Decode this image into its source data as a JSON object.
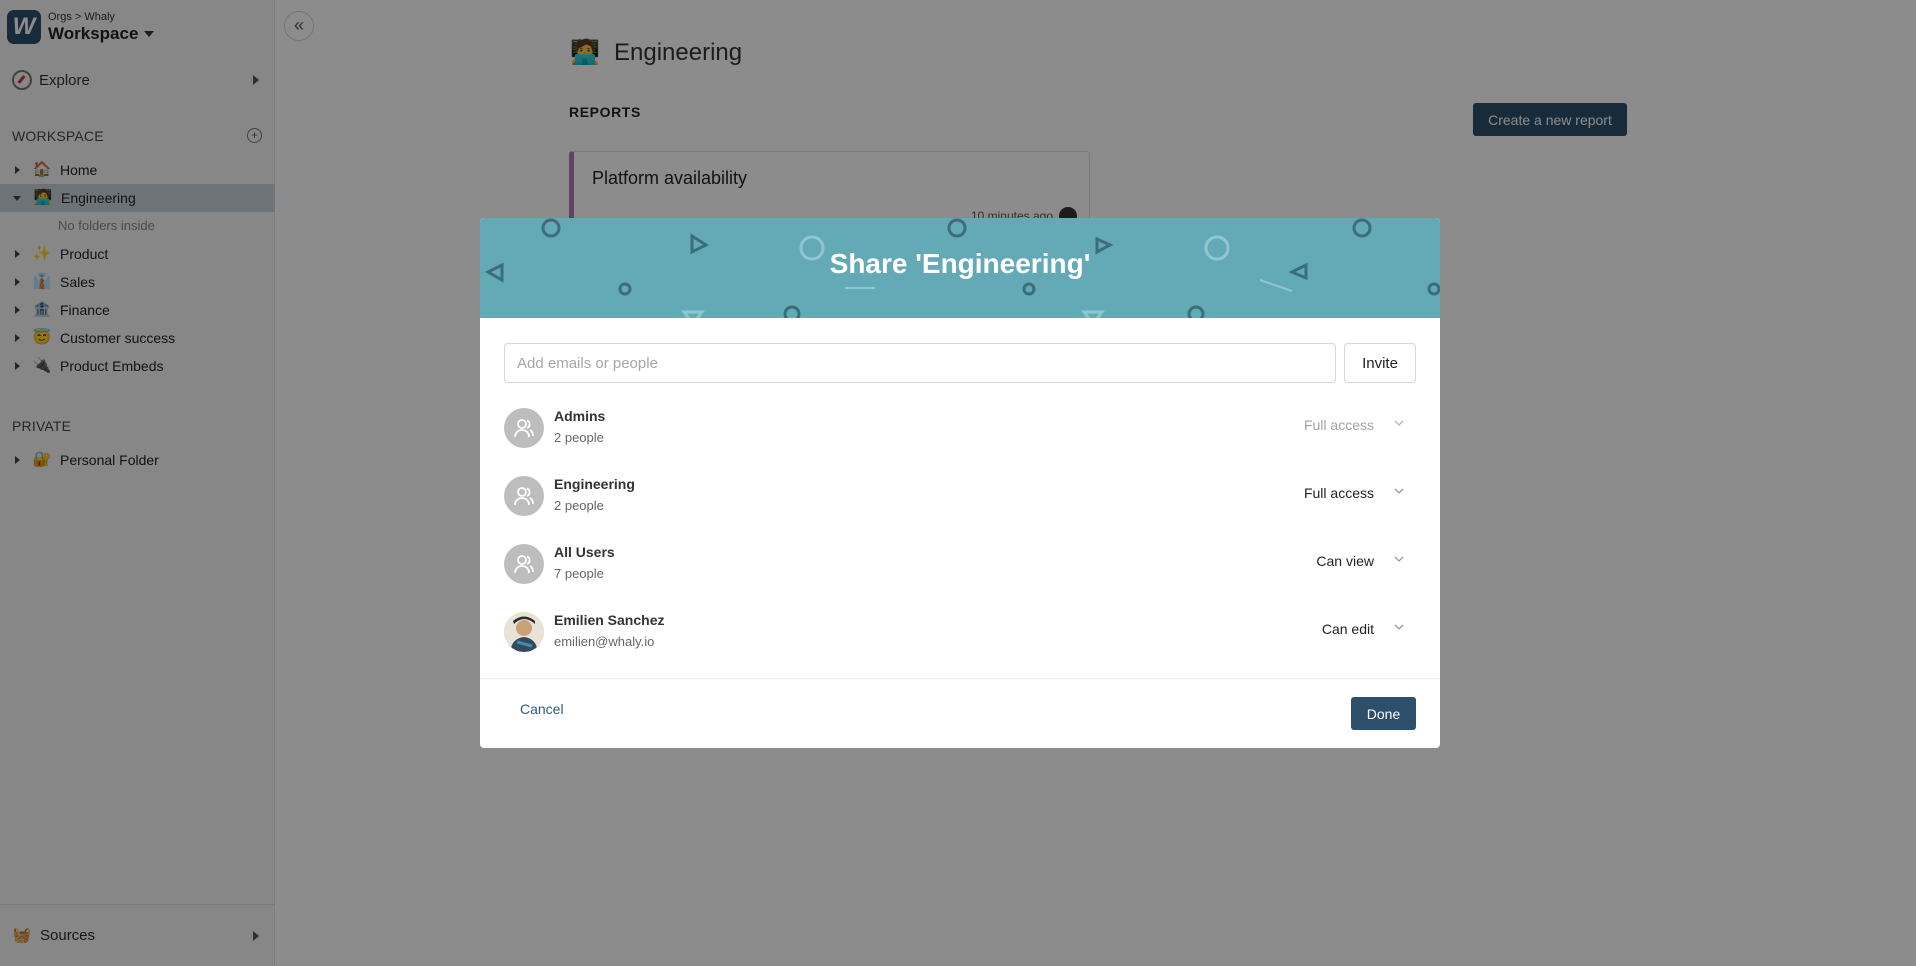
{
  "org": {
    "breadcrumb": "Orgs > Whaly",
    "name": "Workspace",
    "logo_letter": "W"
  },
  "sidebar": {
    "explore_label": "Explore",
    "workspace_heading": "WORKSPACE",
    "items": [
      {
        "label": "Home",
        "icon": "house-icon"
      },
      {
        "label": "Engineering",
        "icon": "technologist-icon"
      },
      {
        "label": "Product",
        "icon": "sparkles-icon"
      },
      {
        "label": "Sales",
        "icon": "businessman-icon"
      },
      {
        "label": "Finance",
        "icon": "bank-icon"
      },
      {
        "label": "Customer success",
        "icon": "smiling-halo-icon"
      },
      {
        "label": "Product Embeds",
        "icon": "plug-icon"
      }
    ],
    "no_folders": "No folders inside",
    "private_heading": "PRIVATE",
    "private_items": [
      {
        "label": "Personal Folder",
        "icon": "locked-folder-icon"
      }
    ],
    "sources_label": "Sources"
  },
  "main": {
    "title": "Engineering",
    "reports_heading": "REPORTS",
    "create_button": "Create a new report",
    "report_card": {
      "title": "Platform availability",
      "time": "10 minutes ago"
    }
  },
  "modal": {
    "title": "Share 'Engineering'",
    "invite_placeholder": "Add emails or people",
    "invite_button": "Invite",
    "members": [
      {
        "name": "Admins",
        "sub": "2 people",
        "access": "Full access",
        "disabled": true
      },
      {
        "name": "Engineering",
        "sub": "2 people",
        "access": "Full access",
        "disabled": false
      },
      {
        "name": "All Users",
        "sub": "7 people",
        "access": "Can view",
        "disabled": false
      },
      {
        "name": "Emilien Sanchez",
        "sub": "emilien@whaly.io",
        "access": "Can edit",
        "disabled": false
      }
    ],
    "cancel_button": "Cancel",
    "done_button": "Done"
  },
  "colors": {
    "primary": "#2d4f6c",
    "modal_header": "#64a9b6",
    "active_item": "#c8d1da"
  }
}
